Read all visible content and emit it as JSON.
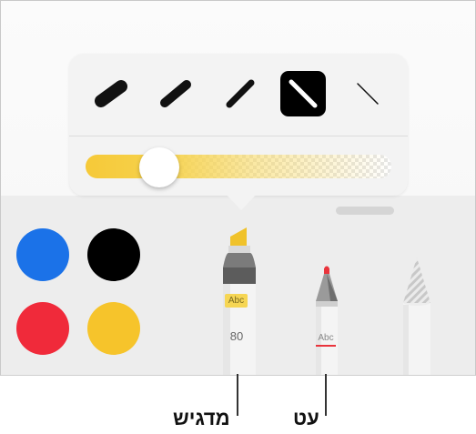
{
  "stroke_widths": [
    {
      "name": "extra-thick"
    },
    {
      "name": "thick"
    },
    {
      "name": "medium"
    },
    {
      "name": "thin",
      "selected": true
    },
    {
      "name": "extra-thin"
    }
  ],
  "opacity_slider": {
    "value": 0.2,
    "color": "#f6c938"
  },
  "colors": [
    {
      "name": "blue",
      "hex": "#1b72e8"
    },
    {
      "name": "black",
      "hex": "#000000"
    },
    {
      "name": "red",
      "hex": "#f02a3a"
    },
    {
      "name": "yellow",
      "hex": "#f6c42b"
    }
  ],
  "tools": {
    "marker": {
      "sample_text": "Abc",
      "size": "80",
      "tip_color": "#f0c22a"
    },
    "pen": {
      "sample_text": "Abc",
      "tip_color": "#e9343c"
    },
    "pencil": {}
  },
  "callouts": {
    "marker_label": "מדגיש",
    "pen_label": "עט"
  }
}
